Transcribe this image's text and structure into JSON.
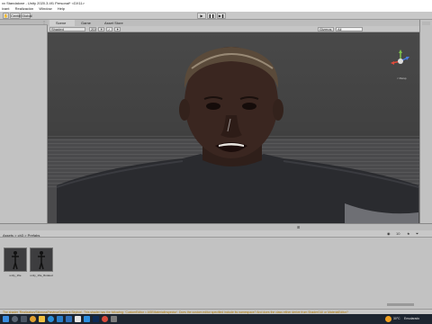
{
  "window": {
    "title": "xx Standalone - Unity 2020.3.4f1 Personal* <DX11>",
    "menu": [
      "ivant",
      "Realización",
      "Window",
      "Help"
    ]
  },
  "toolbar": {
    "center_btn": "Center",
    "global_btn": "Global",
    "play": "▶",
    "pause": "❚❚",
    "step": "▶❚"
  },
  "scene_tabs": [
    "Scene",
    "Game",
    "Asset Store"
  ],
  "scene_toolbar": {
    "shading": "Shaded",
    "gizmos": "Gizmos",
    "search": "All"
  },
  "gizmo": {
    "persp_label": "< Persp"
  },
  "project": {
    "breadcrumb": "Assets > ch3 > Prefabs",
    "count": "10",
    "assets": [
      {
        "label": "unity_16e"
      },
      {
        "label": "unity_16e_Rotated"
      }
    ]
  },
  "status": {
    "message": "The shader 'Realization/SkinrossPreview/Gradient Skybox'. This shader has the following: 'CustomEditor = ASEMaterialInspector'. Does the custom editor specified include its namespace? And does the class either derive from ShaderGUI or MaterialEditor?"
  },
  "taskbar": {
    "weather": "30°C",
    "weather_desc": "Ensolarado",
    "icons": [
      "windows-start",
      "search",
      "task-view",
      "chrome",
      "explorer",
      "edge",
      "store",
      "mail",
      "unity",
      "vscode",
      "photoshop",
      "media",
      "settings"
    ]
  }
}
